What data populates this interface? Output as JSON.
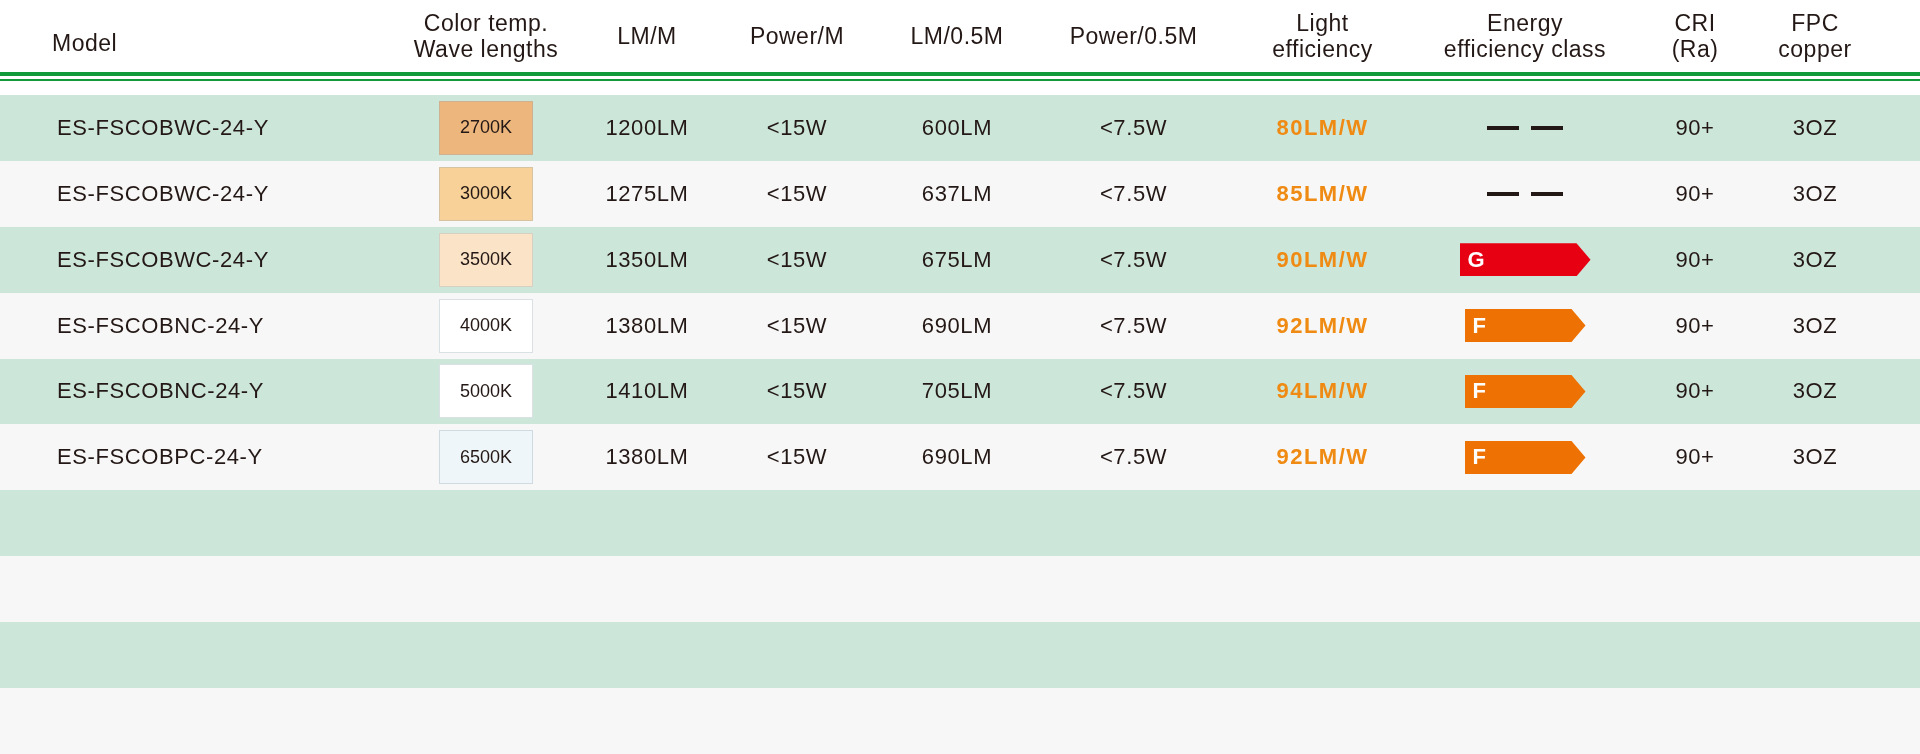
{
  "columns": [
    {
      "label": "Model"
    },
    {
      "label": "Color temp.\nWave lengths"
    },
    {
      "label": "LM/M"
    },
    {
      "label": "Power/M"
    },
    {
      "label": "LM/0.5M"
    },
    {
      "label": "Power/0.5M"
    },
    {
      "label": "Light\nefficiency"
    },
    {
      "label": "Energy\nefficiency class"
    },
    {
      "label": "CRI\n(Ra)"
    },
    {
      "label": "FPC\ncopper"
    }
  ],
  "rows": [
    {
      "kind": "product",
      "model": "ES-FSCOBWC-24-Y",
      "cct": {
        "label": "2700K",
        "color": "#ecb67d"
      },
      "lm_m": "1200LM",
      "power_m": "<15W",
      "lm_half": "600LM",
      "power_half": "<7.5W",
      "efficiency": "80LM/W",
      "energy_class": {
        "kind": "dash"
      },
      "cri": "90+",
      "fpc": "3OZ"
    },
    {
      "kind": "product",
      "model": "ES-FSCOBWC-24-Y",
      "cct": {
        "label": "3000K",
        "color": "#f7d198"
      },
      "lm_m": "1275LM",
      "power_m": "<15W",
      "lm_half": "637LM",
      "power_half": "<7.5W",
      "efficiency": "85LM/W",
      "energy_class": {
        "kind": "dash"
      },
      "cri": "90+",
      "fpc": "3OZ"
    },
    {
      "kind": "product",
      "model": "ES-FSCOBWC-24-Y",
      "cct": {
        "label": "3500K",
        "color": "#fbe3c8"
      },
      "lm_m": "1350LM",
      "power_m": "<15W",
      "lm_half": "675LM",
      "power_half": "<7.5W",
      "efficiency": "90LM/W",
      "energy_class": {
        "kind": "label",
        "label": "G",
        "color": "#e60012"
      },
      "cri": "90+",
      "fpc": "3OZ"
    },
    {
      "kind": "product",
      "model": "ES-FSCOBNC-24-Y",
      "cct": {
        "label": "4000K",
        "color": "#ffffff"
      },
      "lm_m": "1380LM",
      "power_m": "<15W",
      "lm_half": "690LM",
      "power_half": "<7.5W",
      "efficiency": "92LM/W",
      "energy_class": {
        "kind": "label",
        "label": "F",
        "color": "#ee7203"
      },
      "cri": "90+",
      "fpc": "3OZ"
    },
    {
      "kind": "product",
      "model": "ES-FSCOBNC-24-Y",
      "cct": {
        "label": "5000K",
        "color": "#ffffff"
      },
      "lm_m": "1410LM",
      "power_m": "<15W",
      "lm_half": "705LM",
      "power_half": "<7.5W",
      "efficiency": "94LM/W",
      "energy_class": {
        "kind": "label",
        "label": "F",
        "color": "#ee7203"
      },
      "cri": "90+",
      "fpc": "3OZ"
    },
    {
      "kind": "product",
      "model": "ES-FSCOBPC-24-Y",
      "cct": {
        "label": "6500K",
        "color": "#eff6f9"
      },
      "lm_m": "1380LM",
      "power_m": "<15W",
      "lm_half": "690LM",
      "power_half": "<7.5W",
      "efficiency": "92LM/W",
      "energy_class": {
        "kind": "label",
        "label": "F",
        "color": "#ee7203"
      },
      "cri": "90+",
      "fpc": "3OZ"
    },
    {
      "kind": "empty"
    },
    {
      "kind": "empty"
    },
    {
      "kind": "empty"
    },
    {
      "kind": "empty"
    }
  ]
}
